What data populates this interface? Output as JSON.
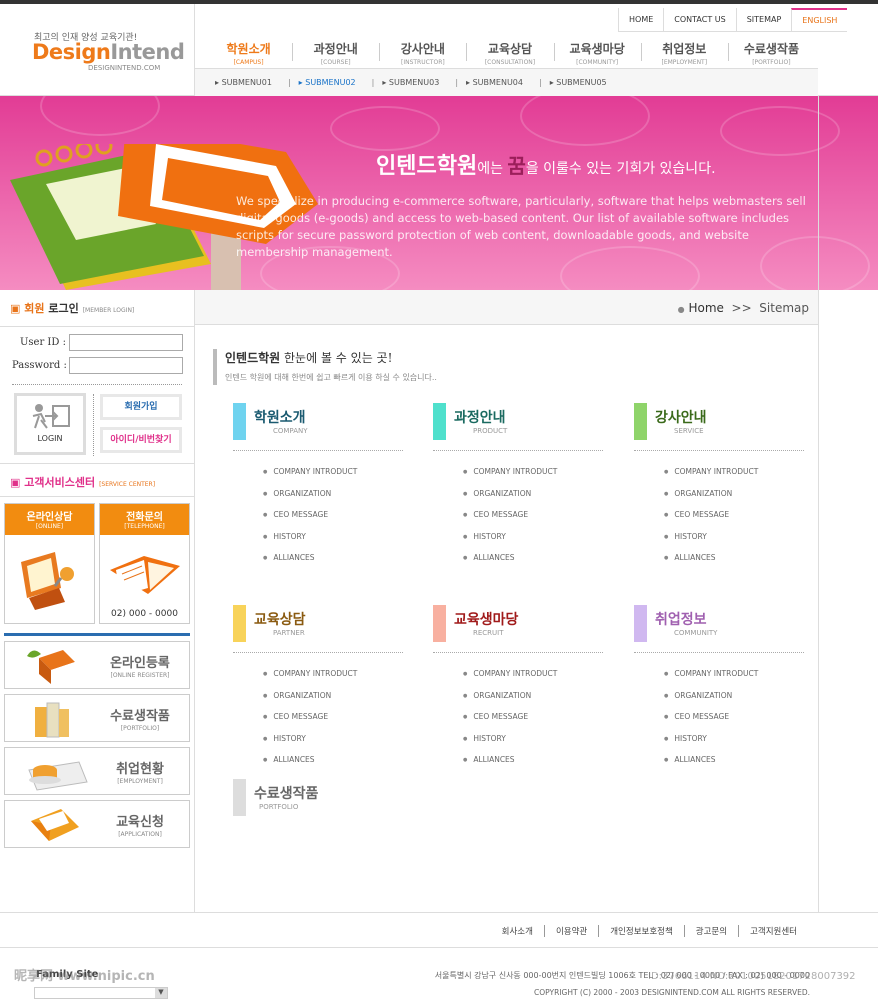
{
  "header": {
    "tagline": "최고의 인재 양성 교육기관!",
    "logo_part1": "Design",
    "logo_part2": "Intend",
    "logo_url": "DESIGNINTEND.COM",
    "util": [
      "HOME",
      "CONTACT US",
      "SITEMAP",
      "ENGLISH"
    ],
    "gnb": [
      {
        "ko": "학원소개",
        "en": "[CAMPUS]"
      },
      {
        "ko": "과정안내",
        "en": "[COURSE]"
      },
      {
        "ko": "강사안내",
        "en": "[INSTRUCTOR]"
      },
      {
        "ko": "교육상담",
        "en": "[CONSULTATION]"
      },
      {
        "ko": "교육생마당",
        "en": "[COMMUNITY]"
      },
      {
        "ko": "취업정보",
        "en": "[EMPLOYMENT]"
      },
      {
        "ko": "수료생작품",
        "en": "[PORTFOLIO]"
      }
    ],
    "submenu": [
      "SUBMENU01",
      "SUBMENU02",
      "SUBMENU03",
      "SUBMENU04",
      "SUBMENU05"
    ]
  },
  "banner": {
    "title_a": "인텐드학원",
    "title_b": "에는 ",
    "title_c": "꿈",
    "title_d": "을 이룰수 있는 기회가 있습니다.",
    "desc": "We specialize in producing e-commerce software, particularly, software that helps webmasters sell digital goods (e-goods) and access to web-based content. Our list of available software includes scripts for secure password protection of web content, downloadable goods, and website membership management."
  },
  "login": {
    "title_a": "회원",
    "title_b": " 로그인",
    "title_en": "[MEMBER LOGIN]",
    "user_id_label": "User ID :",
    "password_label": "Password :",
    "login_button": "LOGIN",
    "join_button": "회원가입",
    "find_button": "아이디/비번찾기"
  },
  "service": {
    "title": "고객서비스센터",
    "title_en": "[SERVICE CENTER]",
    "online": {
      "title": "온라인상담",
      "en": "[ONLINE]"
    },
    "phone": {
      "title": "전화문의",
      "en": "[TELEPHONE]",
      "number": "02) 000 - 0000"
    }
  },
  "quick": [
    {
      "ko": "온라인등록",
      "en": "[ONLINE REGISTER]"
    },
    {
      "ko": "수료생작품",
      "en": "[PORTFOLIO]"
    },
    {
      "ko": "취업현황",
      "en": "[EMPLOYMENT]"
    },
    {
      "ko": "교육신청",
      "en": "[APPLICATION]"
    }
  ],
  "location": {
    "home": "Home",
    "sep": ">>",
    "current": "Sitemap"
  },
  "content": {
    "title_a": "인텐드학원",
    "title_b": " 한눈에 볼 수 있는 곳!",
    "subtitle": "인텐드 학원에 대해 한번에 쉽고 빠르게 이용 하실 수 있습니다..",
    "categories": [
      {
        "ko": "학원소개",
        "en": "COMPANY",
        "color": "#6fd3ef",
        "text": "#1a5a70"
      },
      {
        "ko": "과정안내",
        "en": "PRODUCT",
        "color": "#4fe0cc",
        "text": "#1a6a60"
      },
      {
        "ko": "강사안내",
        "en": "SERVICE",
        "color": "#8fd46a",
        "text": "#3a6a1a"
      },
      {
        "ko": "교육상담",
        "en": "PARTNER",
        "color": "#f8d35a",
        "text": "#8a5a10"
      },
      {
        "ko": "교육생마당",
        "en": "RECRUIT",
        "color": "#f8b0a0",
        "text": "#a01a1a"
      },
      {
        "ko": "취업정보",
        "en": "COMMUNITY",
        "color": "#d0b8f0",
        "text": "#a060b0"
      },
      {
        "ko": "수료생작품",
        "en": "PORTFOLIO",
        "color": "#dddddd",
        "text": "#666666"
      }
    ],
    "items": [
      "COMPANY INTRODUCT",
      "ORGANIZATION",
      "CEO MESSAGE",
      "HISTORY",
      "ALLIANCES"
    ]
  },
  "footer": {
    "links": [
      "회사소개",
      "이용약관",
      "개인정보보호정책",
      "광고문의",
      "고객지원센터"
    ],
    "family_site": "Family Site",
    "address": "서울특별시 강남구 신사동 000-00번지 인텐드빌딩 1006호  TEL : 02) 000 - 0000 / FAX : 02) 000 - 0000",
    "copyright": "COPYRIGHT (C) 2000 - 2003 DESIGNINTEND.COM  ALL RIGHTS RESERVED.",
    "watermark": "昵享网 www.nipic.cn",
    "watermark_id": "ID:3766114 NO:20100518201728007392"
  }
}
